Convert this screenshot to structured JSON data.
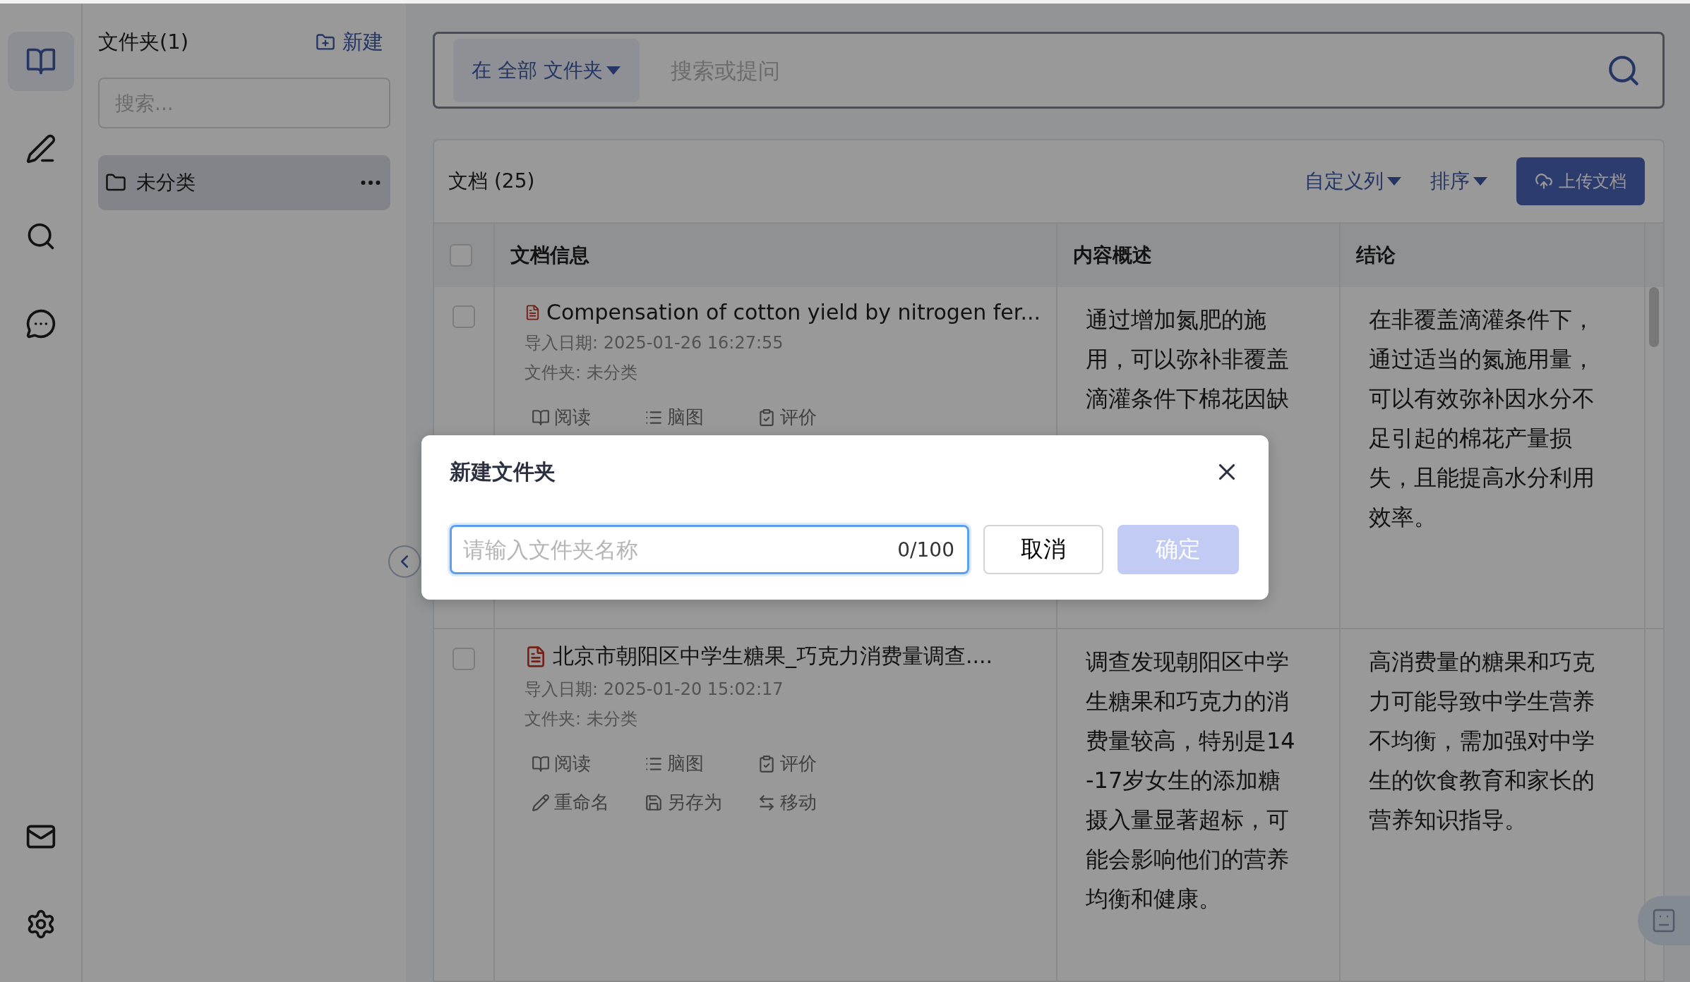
{
  "rail": [
    {
      "selected": true
    },
    {
      "selected": false
    },
    {
      "selected": false
    },
    {
      "selected": false
    },
    {
      "selected": false
    },
    {
      "selected": false
    }
  ],
  "folders": {
    "title": "文件夹(1)",
    "new_label": "新建",
    "search_placeholder": "搜索...",
    "items": [
      {
        "name": "未分类",
        "selected": true
      }
    ]
  },
  "search": {
    "scope": "在 全部 文件夹",
    "placeholder": "搜索或提问"
  },
  "documents": {
    "title": "文档 (25)",
    "custom_columns": "自定义列",
    "sort": "排序",
    "upload": "上传文档",
    "select_all_checked": false,
    "columns": [
      "文档信息",
      "内容概述",
      "结论"
    ],
    "rows": [
      {
        "checked": false,
        "title": "Compensation of cotton yield by nitrogen fer...",
        "date": "导入日期: 2025-01-26 16:27:55",
        "folder": "文件夹: 未分类",
        "actions": [
          "阅读",
          "脑图",
          "评价"
        ],
        "summary": "通过增加氮肥的施用，可以弥补非覆盖滴灌条件下棉花因缺",
        "conclusion": "在非覆盖滴灌条件下，通过适当的氮施用量，可以有效弥补因水分不足引起的棉花产量损失，且能提高水分利用效率。"
      },
      {
        "checked": false,
        "title": "北京市朝阳区中学生糖果_巧克力消费量调查....",
        "date": "导入日期: 2025-01-20 15:02:17",
        "folder": "文件夹: 未分类",
        "actions": [
          "阅读",
          "脑图",
          "评价",
          "重命名",
          "另存为",
          "移动"
        ],
        "summary": "调查发现朝阳区中学生糖果和巧克力的消费量较高，特别是14-17岁女生的添加糖摄入量显著超标，可能会影响他们的营养均衡和健康。",
        "conclusion": "高消费量的糖果和巧克力可能导致中学生营养不均衡，需加强对中学生的饮食教育和家长的营养知识指导。"
      }
    ]
  },
  "dialog": {
    "title": "新建文件夹",
    "placeholder": "请输入文件夹名称",
    "counter": "0/100",
    "cancel": "取消",
    "confirm": "确定",
    "confirm_disabled": true
  }
}
